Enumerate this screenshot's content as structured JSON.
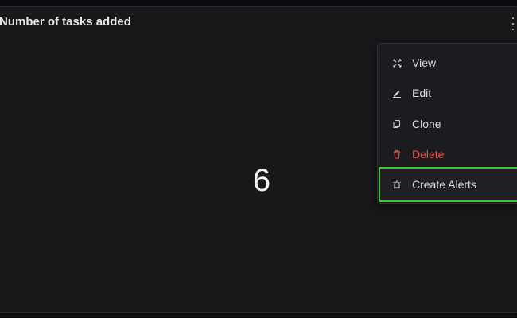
{
  "panel": {
    "title": "Number of tasks added",
    "value": "6"
  },
  "menu": {
    "items": [
      {
        "label": "View",
        "icon": "expand-icon"
      },
      {
        "label": "Edit",
        "icon": "pencil-icon"
      },
      {
        "label": "Clone",
        "icon": "copy-icon"
      },
      {
        "label": "Delete",
        "icon": "trash-icon",
        "color": "#e5534b"
      },
      {
        "label": "Create Alerts",
        "icon": "alarm-icon",
        "highlight_color": "#3ec43e"
      }
    ]
  },
  "colors": {
    "background": "#18181b",
    "text": "#e8e8ea",
    "danger": "#e5534b",
    "highlight": "#3ec43e"
  }
}
